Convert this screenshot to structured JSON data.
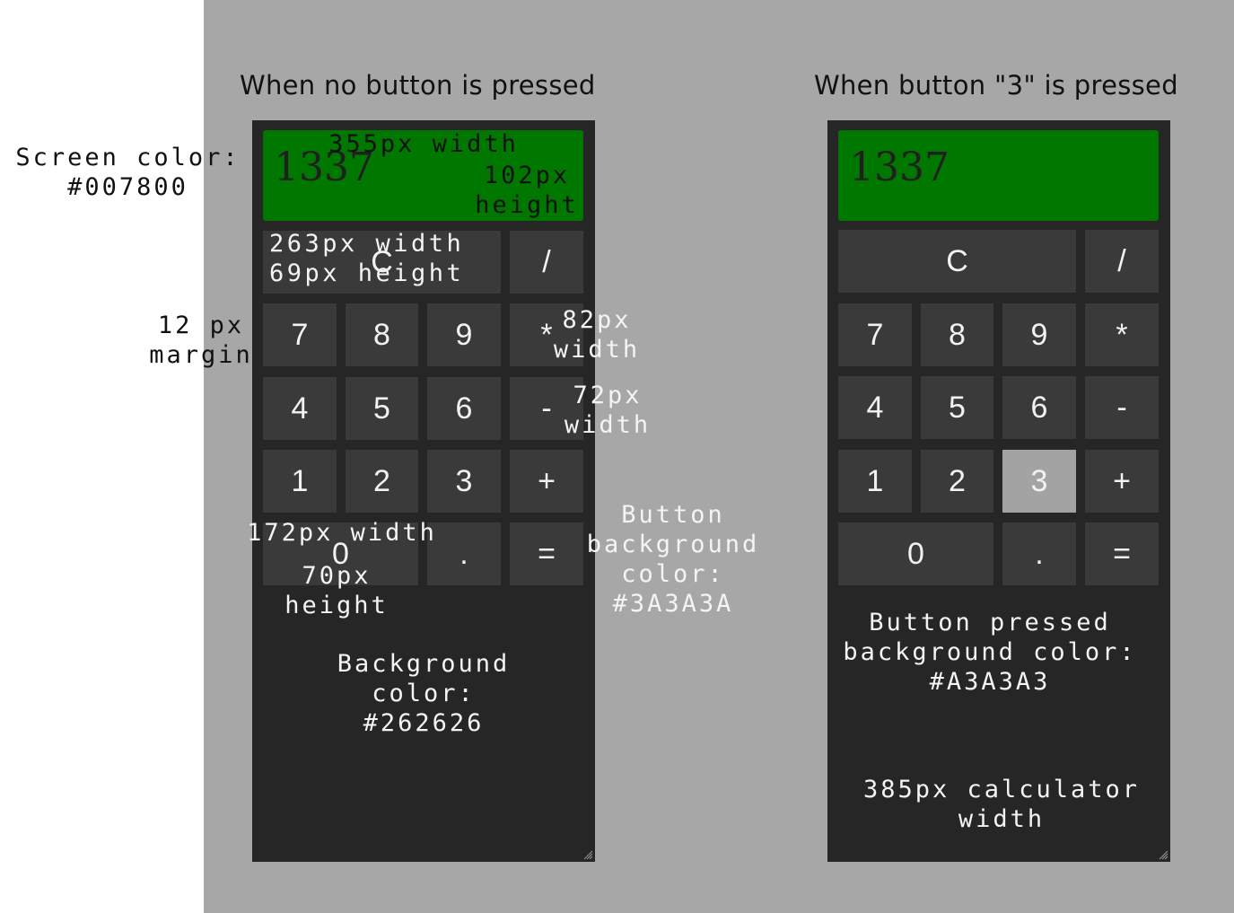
{
  "headings": {
    "left": "When no button is pressed",
    "right": "When button \"3\" is pressed"
  },
  "screen_value": "1337",
  "buttons": {
    "clear": "C",
    "divide": "/",
    "seven": "7",
    "eight": "8",
    "nine": "9",
    "multiply": "*",
    "four": "4",
    "five": "5",
    "six": "6",
    "minus": "-",
    "one": "1",
    "two": "2",
    "three": "3",
    "plus": "+",
    "zero": "0",
    "dot": ".",
    "equals": "="
  },
  "pressed_button": "3",
  "annotations": {
    "screen_color": "Screen color:\n#007800",
    "screen_width": "355px width",
    "screen_height": "102px\nheight",
    "clear_size": "263px width\n69px height",
    "margin": "12 px\nmargin",
    "operator_width": "82px\nwidth",
    "button_width": "72px\nwidth",
    "zero_size": "172px width",
    "zero_height": "70px\nheight",
    "button_bg": "Button\nbackground\ncolor:\n#3A3A3A",
    "bg_color": "Background\ncolor:\n#262626",
    "pressed_bg": "Button pressed\nbackground color:\n#A3A3A3",
    "calc_width": "385px calculator\nwidth"
  },
  "colors": {
    "screen": "#007800",
    "button": "#3A3A3A",
    "button_pressed": "#A3A3A3",
    "background": "#262626",
    "page": "#A7A7A7"
  },
  "icons": {
    "resize_handle": "resize-grip-icon"
  }
}
